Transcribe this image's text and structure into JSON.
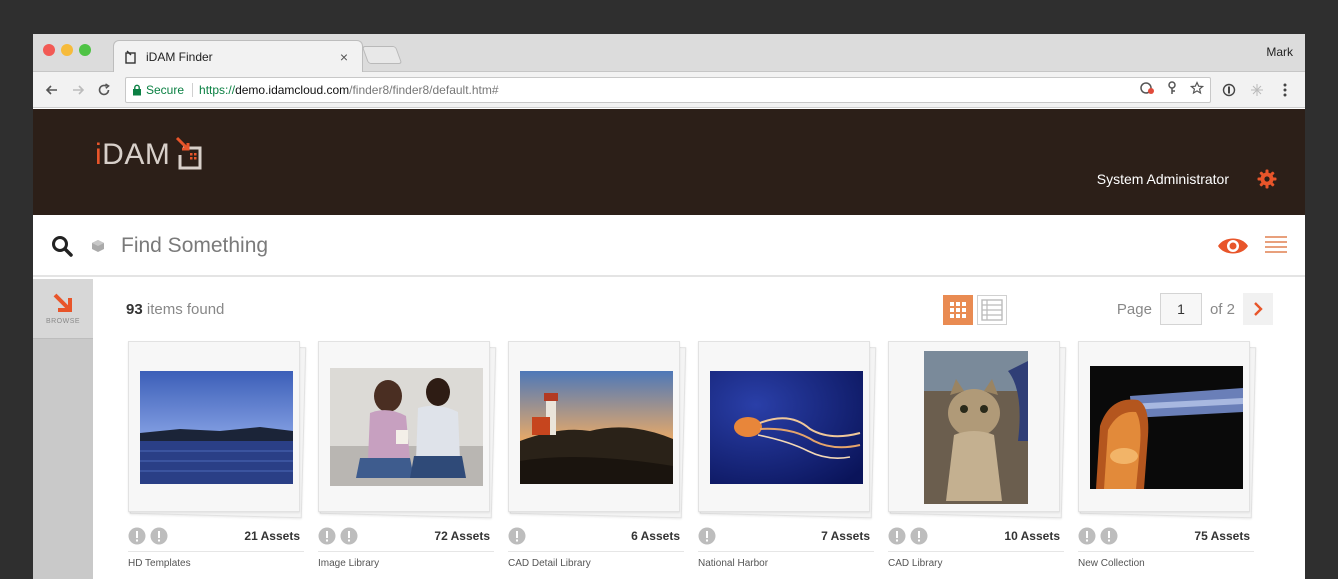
{
  "browser": {
    "tab_title": "iDAM Finder",
    "tab_close": "×",
    "profile_name": "Mark",
    "secure_label": "Secure",
    "url_scheme": "https://",
    "url_host": "demo.idamcloud.com",
    "url_path": "/finder8/finder8/default.htm#"
  },
  "header": {
    "logo_i": "i",
    "logo_rest": "DAM",
    "user_name": "System Administrator",
    "accent_color": "#e8552a",
    "background_color": "#2c1f18"
  },
  "search": {
    "placeholder": "Find Something"
  },
  "rail": {
    "browse_label": "BROWSE"
  },
  "results": {
    "count": "93",
    "count_suffix": "items found",
    "page_label": "Page",
    "page_value": "1",
    "page_total": "of 2"
  },
  "collections": [
    {
      "name": "HD Templates",
      "assets": "21 Assets",
      "icons": 2,
      "image": "harbor-dusk"
    },
    {
      "name": "Image Library",
      "assets": "72 Assets",
      "icons": 2,
      "image": "couple-on-sofa"
    },
    {
      "name": "CAD Detail Library",
      "assets": "6 Assets",
      "icons": 1,
      "image": "lighthouse"
    },
    {
      "name": "National Harbor",
      "assets": "7 Assets",
      "icons": 1,
      "image": "jellyfish"
    },
    {
      "name": "CAD Library",
      "assets": "10 Assets",
      "icons": 2,
      "image": "kitten"
    },
    {
      "name": "New Collection",
      "assets": "75 Assets",
      "icons": 2,
      "image": "metal-pipe"
    }
  ]
}
